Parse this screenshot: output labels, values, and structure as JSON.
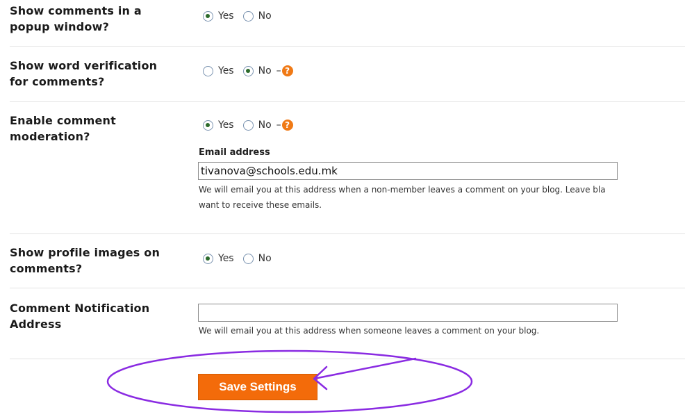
{
  "settings": {
    "popup": {
      "label_line1": "Show comments in a",
      "label_line2": "popup window?",
      "yes_label": "Yes",
      "no_label": "No",
      "selected": "Yes"
    },
    "word_verification": {
      "label_line1": "Show word verification",
      "label_line2": "for comments?",
      "yes_label": "Yes",
      "no_label": "No",
      "selected": "No",
      "help_dash": "–",
      "help_icon": "help-icon",
      "help_glyph": "?"
    },
    "moderation": {
      "label_line1": "Enable comment",
      "label_line2": "moderation?",
      "yes_label": "Yes",
      "no_label": "No",
      "selected": "Yes",
      "help_dash": "–",
      "help_icon": "help-icon",
      "help_glyph": "?",
      "email_label": "Email address",
      "email_value": "tivanova@schools.edu.mk",
      "help_text_line1": "We will email you at this address when a non-member leaves a comment on your blog. Leave bla",
      "help_text_line2": "want to receive these emails."
    },
    "profile_images": {
      "label_line1": "Show profile images on",
      "label_line2": "comments?",
      "yes_label": "Yes",
      "no_label": "No",
      "selected": "Yes"
    },
    "notification": {
      "label_line1": "Comment Notification",
      "label_line2": "Address",
      "value": "",
      "help_text": "We will email you at this address when someone leaves a comment on your blog."
    }
  },
  "save_button": {
    "label": "Save Settings"
  },
  "colors": {
    "accent": "#f36b0a",
    "annotation": "#8a2be2",
    "radio_dot": "#2c6b2c"
  }
}
